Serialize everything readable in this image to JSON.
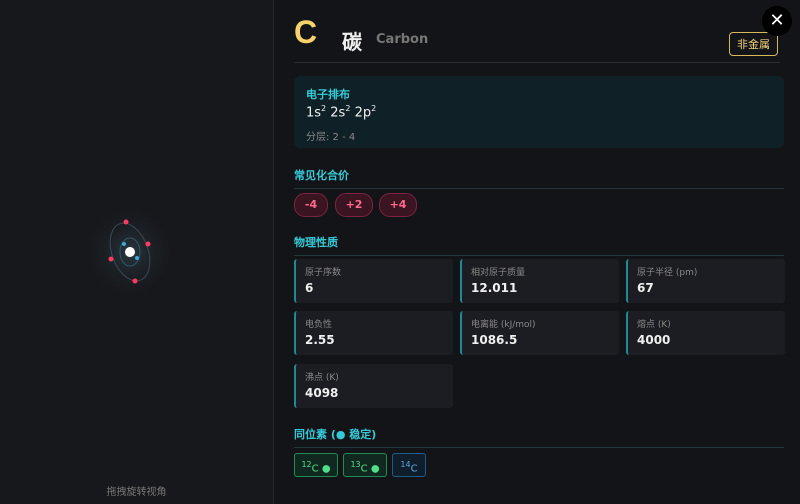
{
  "viewer": {
    "hint": "拖拽旋转视角"
  },
  "element": {
    "symbol": "C",
    "name_cn": "碳",
    "name_en": "Carbon",
    "category": "非金属",
    "close_label": "✕"
  },
  "electron_config": {
    "title": "电子排布",
    "shells_label": "分层: 2 - 4",
    "orbitals": [
      {
        "base": "1s",
        "sup": "2"
      },
      {
        "base": "2s",
        "sup": "2"
      },
      {
        "base": "2p",
        "sup": "2"
      }
    ]
  },
  "oxidation": {
    "title": "常见化合价",
    "states": [
      "-4",
      "+2",
      "+4"
    ]
  },
  "physical": {
    "title": "物理性质",
    "props": [
      {
        "label": "原子序数",
        "value": "6"
      },
      {
        "label": "相对原子质量",
        "value": "12.011"
      },
      {
        "label": "原子半径 (pm)",
        "value": "67"
      },
      {
        "label": "电负性",
        "value": "2.55"
      },
      {
        "label": "电离能 (kJ/mol)",
        "value": "1086.5"
      },
      {
        "label": "熔点 (K)",
        "value": "4000"
      },
      {
        "label": "沸点 (K)",
        "value": "4098"
      }
    ]
  },
  "isotopes": {
    "title": "同位素 (● 稳定)",
    "items": [
      {
        "mass": "12",
        "symbol": "C",
        "stable_mark": "●"
      },
      {
        "mass": "13",
        "symbol": "C",
        "stable_mark": "●"
      },
      {
        "mass": "14",
        "symbol": "C",
        "stable_mark": ""
      }
    ]
  }
}
